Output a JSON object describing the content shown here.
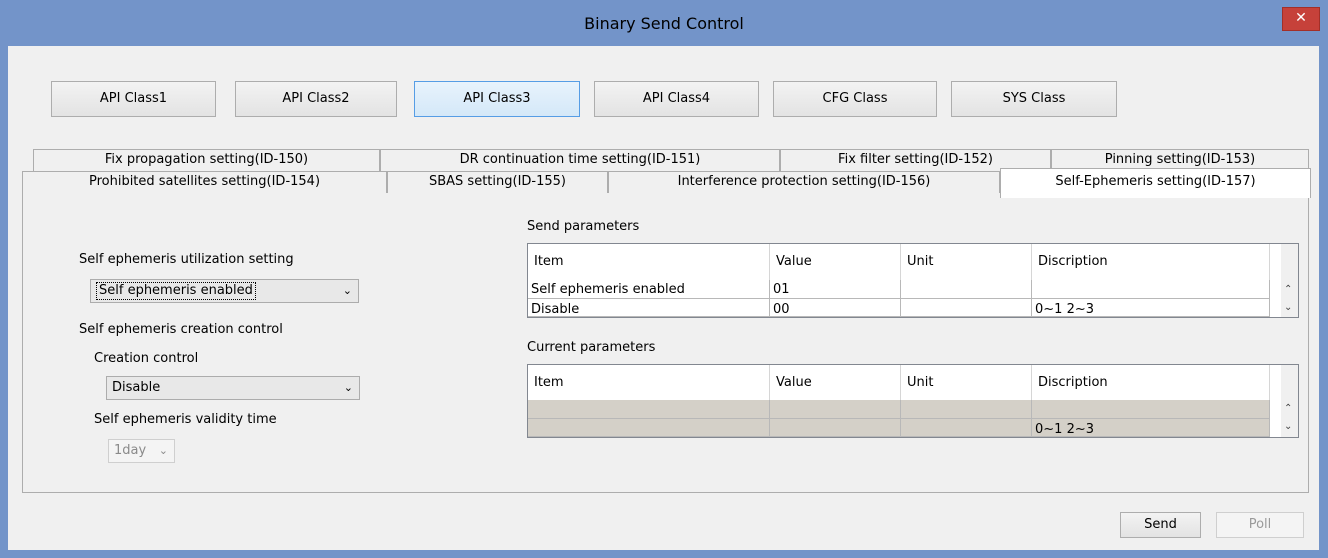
{
  "window": {
    "title": "Binary Send Control",
    "close_glyph": "✕"
  },
  "class_buttons": [
    "API Class1",
    "API Class2",
    "API Class3",
    "API Class4",
    "CFG Class",
    "SYS Class"
  ],
  "active_class": "API Class3",
  "tabs_row1": [
    "Fix propagation setting(ID-150)",
    "DR continuation time setting(ID-151)",
    "Fix filter setting(ID-152)",
    "Pinning setting(ID-153)"
  ],
  "tabs_row2": [
    "Prohibited satellites setting(ID-154)",
    "SBAS setting(ID-155)",
    "Interference protection setting(ID-156)",
    "Self-Ephemeris setting(ID-157)"
  ],
  "selected_tab": "Self-Ephemeris setting(ID-157)",
  "left": {
    "utilization_label": "Self ephemeris utilization setting",
    "utilization_value": "Self ephemeris enabled",
    "creation_group_label": "Self ephemeris creation control",
    "creation_label": "Creation control",
    "creation_value": "Disable",
    "validity_label": "Self ephemeris validity time",
    "validity_value": "1day"
  },
  "send_params": {
    "title": "Send parameters",
    "columns": [
      "Item",
      "Value",
      "Unit",
      "Discription"
    ],
    "rows": [
      [
        "Self ephemeris enabled",
        "01",
        "",
        ""
      ],
      [
        "Disable",
        "00",
        "",
        "0~1 2~3"
      ]
    ]
  },
  "current_params": {
    "title": "Current parameters",
    "columns": [
      "Item",
      "Value",
      "Unit",
      "Discription"
    ],
    "rows": [
      [
        "",
        "",
        "",
        ""
      ],
      [
        "",
        "",
        "",
        "0~1 2~3"
      ]
    ]
  },
  "actions": {
    "send": "Send",
    "poll": "Poll"
  },
  "colors": {
    "title_bar": "#7394c9",
    "close": "#c6413a",
    "active_button": "#d4e8f8",
    "grid_gray": "#d4d0c8"
  }
}
